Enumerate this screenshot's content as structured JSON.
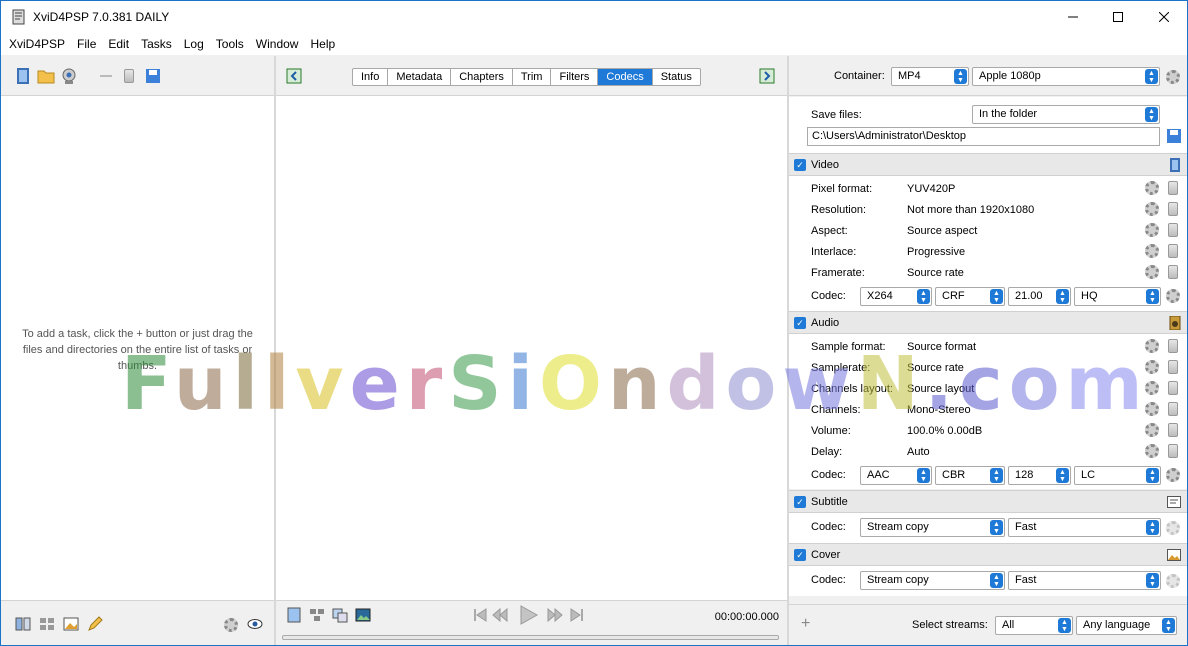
{
  "window": {
    "title": "XviD4PSP 7.0.381 DAILY"
  },
  "menu": [
    "XviD4PSP",
    "File",
    "Edit",
    "Tasks",
    "Log",
    "Tools",
    "Window",
    "Help"
  ],
  "left": {
    "hint": "To add a task, click the + button or just drag the files and directories on the entire list of tasks or thumbs."
  },
  "tabs": [
    "Info",
    "Metadata",
    "Chapters",
    "Trim",
    "Filters",
    "Codecs",
    "Status"
  ],
  "active_tab": "Codecs",
  "player": {
    "time": "00:00:00.000"
  },
  "right": {
    "container_label": "Container:",
    "container": "MP4",
    "preset": "Apple 1080p",
    "save_label": "Save files:",
    "save_mode": "In the folder",
    "save_path": "C:\\Users\\Administrator\\Desktop",
    "video": {
      "title": "Video",
      "rows": [
        {
          "label": "Pixel format:",
          "value": "YUV420P"
        },
        {
          "label": "Resolution:",
          "value": "Not more than 1920x1080"
        },
        {
          "label": "Aspect:",
          "value": "Source aspect"
        },
        {
          "label": "Interlace:",
          "value": "Progressive"
        },
        {
          "label": "Framerate:",
          "value": "Source rate"
        }
      ],
      "codec_label": "Codec:",
      "codec": "X264",
      "mode": "CRF",
      "quality": "21.00",
      "preset": "HQ"
    },
    "audio": {
      "title": "Audio",
      "rows": [
        {
          "label": "Sample format:",
          "value": "Source format"
        },
        {
          "label": "Samplerate:",
          "value": "Source rate"
        },
        {
          "label": "Channels layout:",
          "value": "Source layout"
        },
        {
          "label": "Channels:",
          "value": "Mono-Stereo"
        },
        {
          "label": "Volume:",
          "value": "100.0% 0.00dB"
        },
        {
          "label": "Delay:",
          "value": "Auto"
        }
      ],
      "codec_label": "Codec:",
      "codec": "AAC",
      "mode": "CBR",
      "bitrate": "128",
      "profile": "LC"
    },
    "subtitle": {
      "title": "Subtitle",
      "codec_label": "Codec:",
      "codec": "Stream copy",
      "speed": "Fast"
    },
    "cover": {
      "title": "Cover",
      "codec_label": "Codec:",
      "codec": "Stream copy",
      "speed": "Fast"
    },
    "streams_label": "Select streams:",
    "streams": "All",
    "language": "Any language"
  },
  "watermark": "FullversiOndowN.com"
}
